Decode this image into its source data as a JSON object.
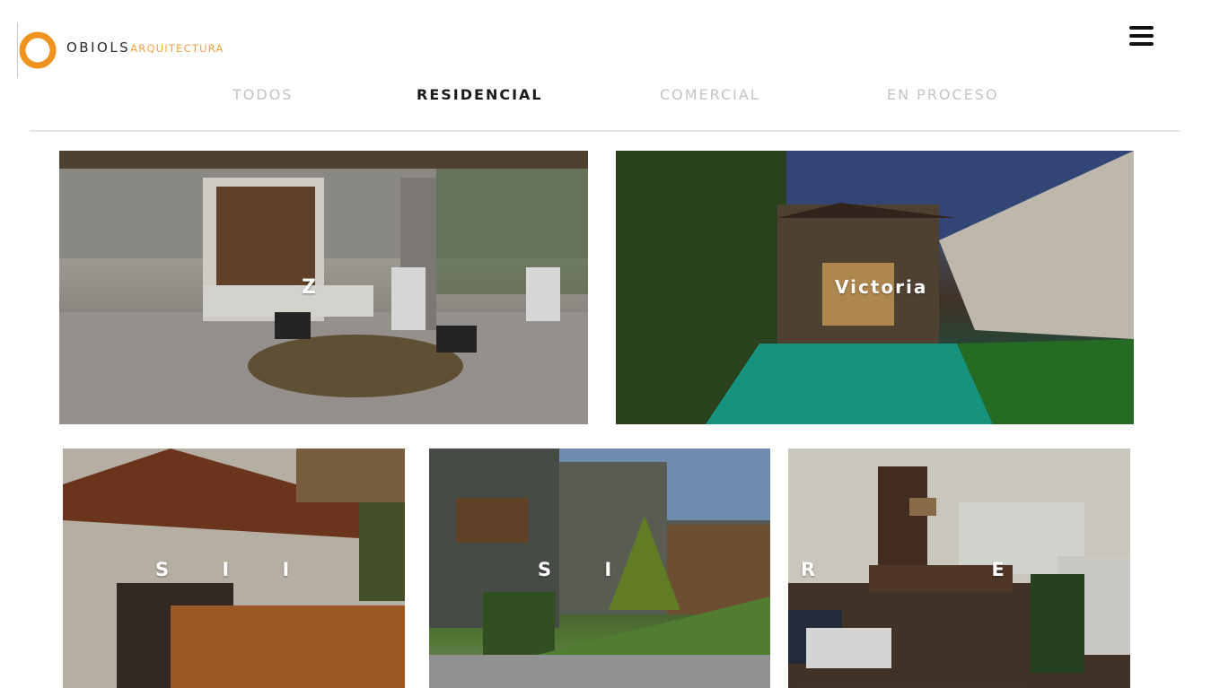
{
  "brand": {
    "name": "OBIOLS",
    "sub": "ARQUITECTURA",
    "accent_color": "#f0921e"
  },
  "header": {
    "menu_icon": "hamburger-icon"
  },
  "filters": {
    "tabs": [
      {
        "label": "TODOS",
        "active": false
      },
      {
        "label": "RESIDENCIAL",
        "active": true
      },
      {
        "label": "COMERCIAL",
        "active": false
      },
      {
        "label": "EN PROCESO",
        "active": false
      }
    ]
  },
  "projects": [
    {
      "label": "Z"
    },
    {
      "label": "Victoria"
    },
    {
      "label": "S I I"
    },
    {
      "label": "S I"
    },
    {
      "label": "R E E"
    }
  ],
  "colors": {
    "active_tab": "#1a1a1a",
    "inactive_tab": "#c3c3c3",
    "divider": "#e4e4e4"
  }
}
